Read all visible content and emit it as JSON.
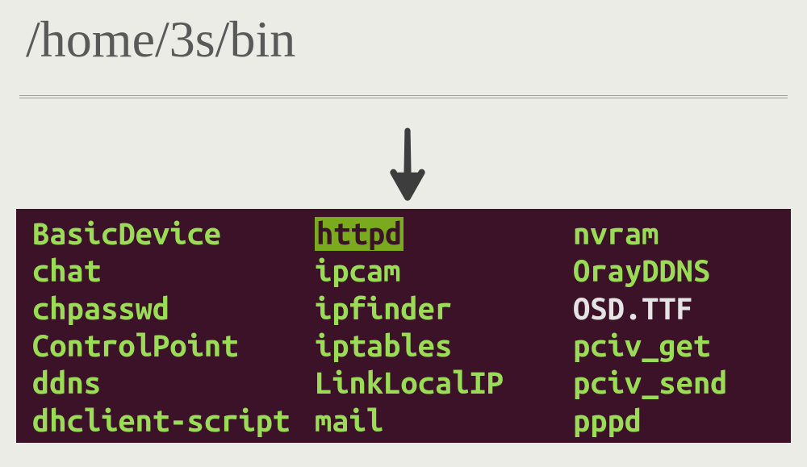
{
  "title": "/home/3s/bin",
  "arrow_icon": "↓",
  "terminal": {
    "columns": [
      {
        "items": [
          {
            "text": "BasicDevice",
            "style": "exec"
          },
          {
            "text": "chat",
            "style": "exec"
          },
          {
            "text": "chpasswd",
            "style": "exec"
          },
          {
            "text": "ControlPoint",
            "style": "exec"
          },
          {
            "text": "ddns",
            "style": "exec"
          },
          {
            "text": "dhclient-script",
            "style": "exec"
          }
        ]
      },
      {
        "items": [
          {
            "text": "httpd",
            "style": "highlighted"
          },
          {
            "text": "ipcam",
            "style": "exec"
          },
          {
            "text": "ipfinder",
            "style": "exec"
          },
          {
            "text": "iptables",
            "style": "exec"
          },
          {
            "text": "LinkLocalIP",
            "style": "exec"
          },
          {
            "text": "mail",
            "style": "exec"
          }
        ]
      },
      {
        "items": [
          {
            "text": "nvram",
            "style": "exec"
          },
          {
            "text": "OrayDDNS",
            "style": "exec"
          },
          {
            "text": "OSD.TTF",
            "style": "file-white"
          },
          {
            "text": "pciv_get",
            "style": "exec"
          },
          {
            "text": "pciv_send",
            "style": "exec"
          },
          {
            "text": "pppd",
            "style": "exec"
          }
        ]
      }
    ]
  }
}
